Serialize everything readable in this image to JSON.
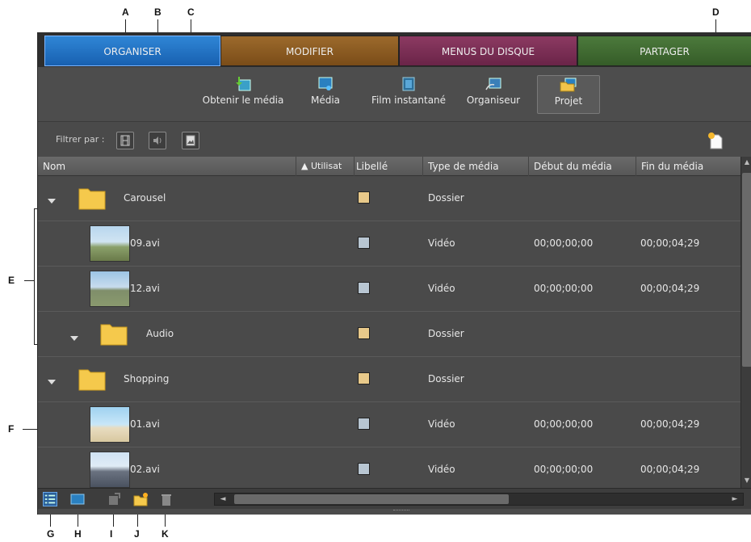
{
  "callouts": [
    "A",
    "B",
    "C",
    "D",
    "E",
    "F",
    "G",
    "H",
    "I",
    "J",
    "K"
  ],
  "tabs": [
    "ORGANISER",
    "MODIFIER",
    "MENUS DU DISQUE",
    "PARTAGER"
  ],
  "toolbar": {
    "get_media": "Obtenir le média",
    "media": "Média",
    "instant_movie": "Film instantané",
    "organizer": "Organiseur",
    "project": "Projet"
  },
  "filter": {
    "label": "Filtrer par :"
  },
  "columns": {
    "name": "Nom",
    "used": "▲ Utilisat",
    "label": "Libellé",
    "type": "Type de média",
    "start": "Début du média",
    "end": "Fin du média"
  },
  "rows": [
    {
      "name": "Carousel",
      "type": "Dossier",
      "start": "",
      "end": ""
    },
    {
      "name": "09.avi",
      "type": "Vidéo",
      "start": "00;00;00;00",
      "end": "00;00;04;29"
    },
    {
      "name": "12.avi",
      "type": "Vidéo",
      "start": "00;00;00;00",
      "end": "00;00;04;29"
    },
    {
      "name": "Audio",
      "type": "Dossier",
      "start": "",
      "end": ""
    },
    {
      "name": "Shopping",
      "type": "Dossier",
      "start": "",
      "end": ""
    },
    {
      "name": "01.avi",
      "type": "Vidéo",
      "start": "00;00;00;00",
      "end": "00;00;04;29"
    },
    {
      "name": "02.avi",
      "type": "Vidéo",
      "start": "00;00;00;00",
      "end": "00;00;04;29"
    }
  ],
  "colors": {
    "folder_label": "#e8c98a",
    "video_label": "#b8c6d2",
    "tab_organiser": "#1f6fc2",
    "tab_modifier": "#8a5a22",
    "tab_menus": "#7a2f55",
    "tab_partager": "#40683a"
  }
}
